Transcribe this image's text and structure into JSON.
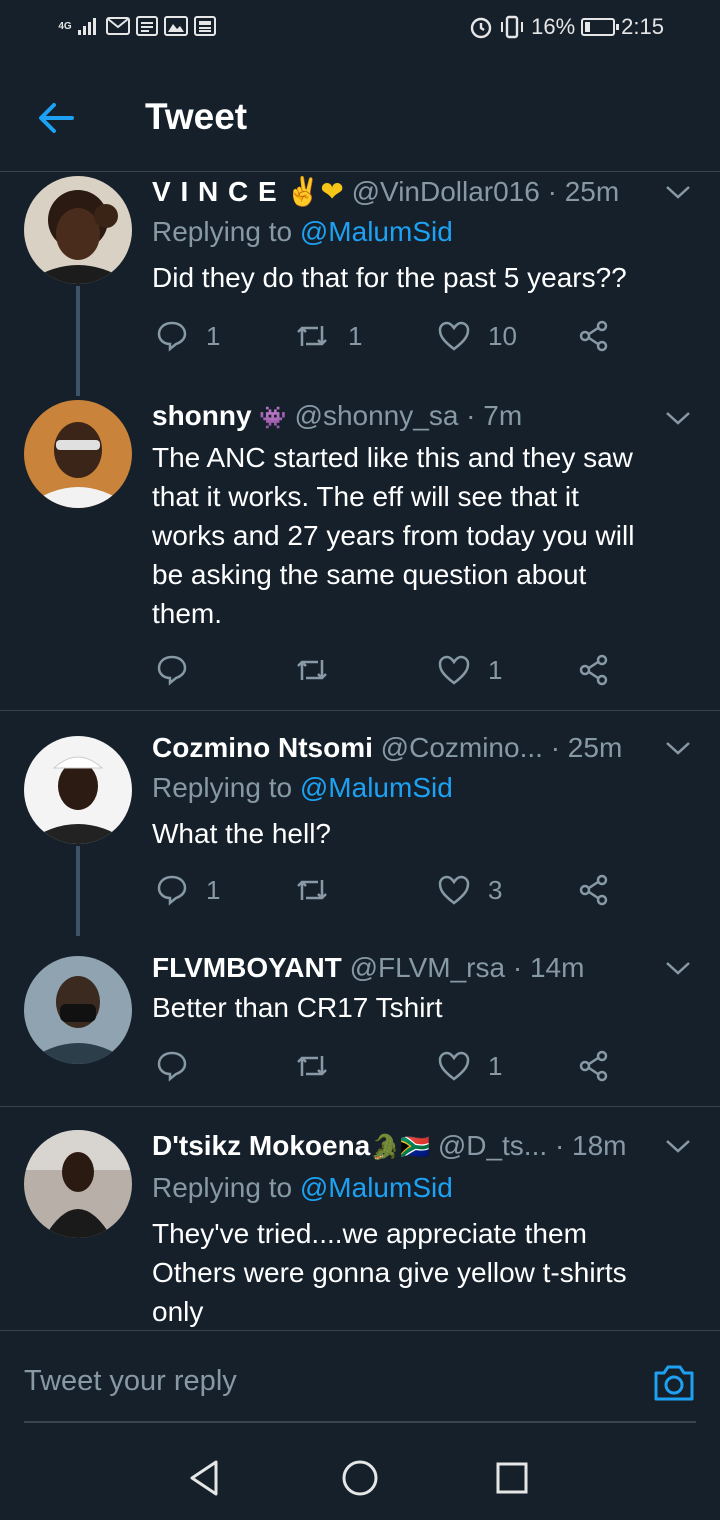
{
  "status_bar": {
    "network": "4G",
    "battery_percent": "16%",
    "time": "2:15",
    "icons": [
      "signal-icon",
      "mail-icon",
      "notes-icon",
      "gallery-icon",
      "news-icon",
      "alarm-icon",
      "vibrate-icon"
    ]
  },
  "header": {
    "title": "Tweet",
    "back_icon": "back-arrow-icon"
  },
  "tweets": [
    {
      "name": "V I N C E",
      "emoji": "✌❤",
      "handle": "@VinDollar016",
      "time": "· 25m",
      "replying_label": "Replying to",
      "replying_to": "@MalumSid",
      "text": [
        "Did they do that for the past 5 years??"
      ],
      "replies": "1",
      "retweets": "1",
      "likes": "10"
    },
    {
      "name": "shonny",
      "emoji": "👾",
      "handle": "@shonny_sa",
      "time": "· 7m",
      "text": [
        "The ANC started like this and they saw",
        "that it works. The eff will see that it",
        "works and 27 years from today you will",
        "be asking the same question about",
        "them."
      ],
      "replies": "",
      "retweets": "",
      "likes": "1"
    },
    {
      "name": "Cozmino Ntsomi",
      "handle": "@Cozmino...",
      "time": "· 25m",
      "replying_label": "Replying to",
      "replying_to": "@MalumSid",
      "text": [
        "What the hell?"
      ],
      "replies": "1",
      "retweets": "",
      "likes": "3"
    },
    {
      "name": "FLVMBOYANT",
      "handle": "@FLVM_rsa",
      "time": "· 14m",
      "text": [
        "Better than CR17 Tshirt"
      ],
      "replies": "",
      "retweets": "",
      "likes": "1"
    },
    {
      "name": "D'tsikz Mokoena",
      "emoji": "🐊🇿🇦",
      "handle": "@D_ts...",
      "time": "· 18m",
      "replying_label": "Replying to",
      "replying_to": "@MalumSid",
      "text": [
        "They've tried....we appreciate them",
        "Others were gonna give yellow t-shirts",
        "only"
      ]
    }
  ],
  "reply_bar": {
    "placeholder": "Tweet your reply",
    "camera_icon": "camera-icon"
  },
  "nav": {
    "icons": [
      "nav-back-icon",
      "nav-home-icon",
      "nav-recents-icon"
    ]
  },
  "colors": {
    "background": "#15202b",
    "accent": "#1da1f2",
    "muted": "#8899a6",
    "divider": "#38444d"
  }
}
